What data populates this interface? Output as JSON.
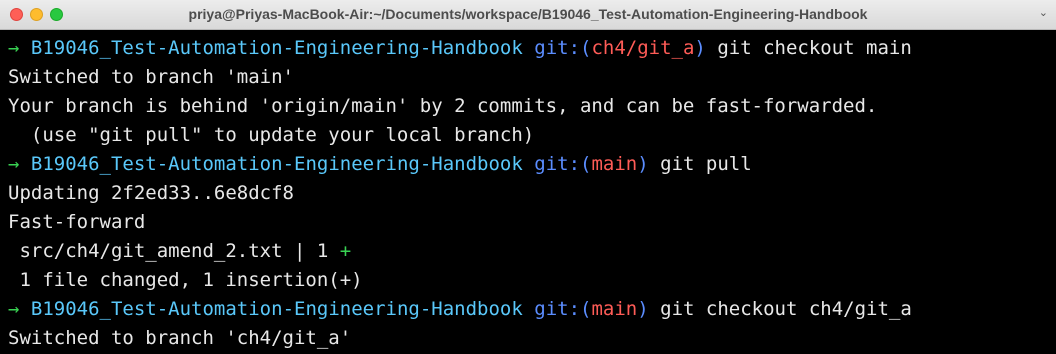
{
  "window": {
    "title": "priya@Priyas-MacBook-Air:~/Documents/workspace/B19046_Test-Automation-Engineering-Handbook"
  },
  "terminal": {
    "prompt_arrow": "→",
    "prompt_dir": "B19046_Test-Automation-Engineering-Handbook",
    "git_prefix": "git:(",
    "git_suffix": ")",
    "lines": [
      {
        "branch": "ch4/git_a",
        "command": "git checkout main"
      },
      "Switched to branch 'main'",
      "Your branch is behind 'origin/main' by 2 commits, and can be fast-forwarded.",
      "  (use \"git pull\" to update your local branch)",
      {
        "branch": "main",
        "command": "git pull"
      },
      "Updating 2f2ed33..6e8dcf8",
      "Fast-forward",
      {
        "text": " src/ch4/git_amend_2.txt | 1 ",
        "plus": "+"
      },
      " 1 file changed, 1 insertion(+)",
      {
        "branch": "main",
        "command": "git checkout ch4/git_a"
      },
      "Switched to branch 'ch4/git_a'"
    ]
  },
  "colors": {
    "arrow": "#39d353",
    "directory": "#5ac8fa",
    "git_label": "#5b8dff",
    "branch": "#ff5c57",
    "output": "#e8e8e8",
    "background": "#000000"
  }
}
